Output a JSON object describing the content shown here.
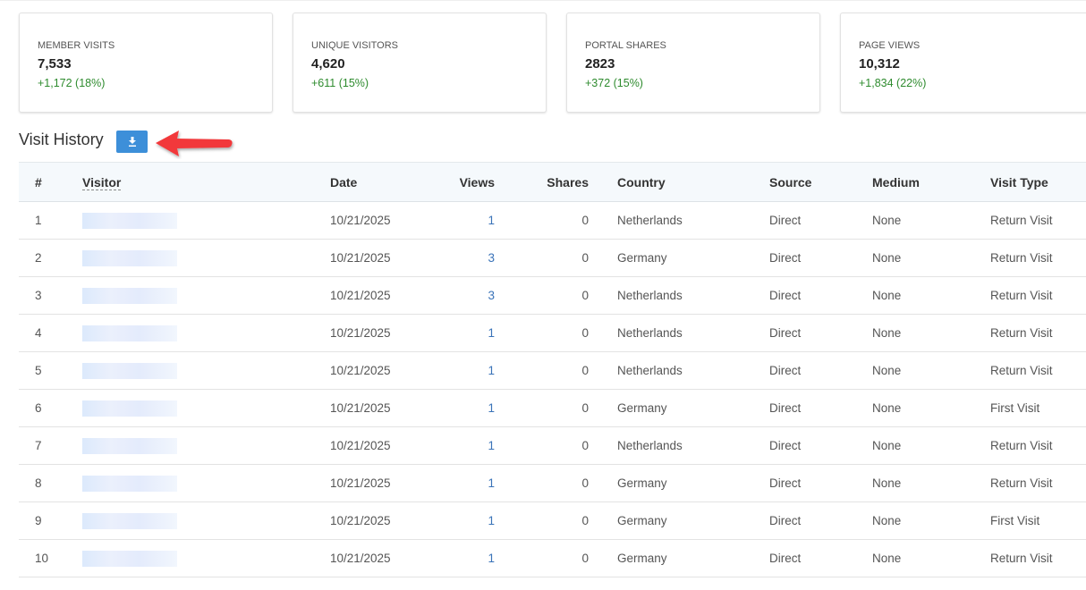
{
  "stats": [
    {
      "label": "MEMBER VISITS",
      "value": "7,533",
      "change": "+1,172 (18%)"
    },
    {
      "label": "UNIQUE VISITORS",
      "value": "4,620",
      "change": "+611 (15%)"
    },
    {
      "label": "PORTAL SHARES",
      "value": "2823",
      "change": "+372 (15%)"
    },
    {
      "label": "PAGE VIEWS",
      "value": "10,312",
      "change": "+1,834 (22%)"
    }
  ],
  "history": {
    "title": "Visit History",
    "download_icon": "download-icon",
    "columns": [
      "#",
      "Visitor",
      "Date",
      "Views",
      "Shares",
      "Country",
      "Source",
      "Medium",
      "Visit Type"
    ],
    "rows": [
      [
        "1",
        "",
        "10/21/2025",
        "1",
        "0",
        "Netherlands",
        "Direct",
        "None",
        "Return Visit"
      ],
      [
        "2",
        "",
        "10/21/2025",
        "3",
        "0",
        "Germany",
        "Direct",
        "None",
        "Return Visit"
      ],
      [
        "3",
        "",
        "10/21/2025",
        "3",
        "0",
        "Netherlands",
        "Direct",
        "None",
        "Return Visit"
      ],
      [
        "4",
        "",
        "10/21/2025",
        "1",
        "0",
        "Netherlands",
        "Direct",
        "None",
        "Return Visit"
      ],
      [
        "5",
        "",
        "10/21/2025",
        "1",
        "0",
        "Netherlands",
        "Direct",
        "None",
        "Return Visit"
      ],
      [
        "6",
        "",
        "10/21/2025",
        "1",
        "0",
        "Germany",
        "Direct",
        "None",
        "First Visit"
      ],
      [
        "7",
        "",
        "10/21/2025",
        "1",
        "0",
        "Netherlands",
        "Direct",
        "None",
        "Return Visit"
      ],
      [
        "8",
        "",
        "10/21/2025",
        "1",
        "0",
        "Germany",
        "Direct",
        "None",
        "Return Visit"
      ],
      [
        "9",
        "",
        "10/21/2025",
        "1",
        "0",
        "Germany",
        "Direct",
        "None",
        "First Visit"
      ],
      [
        "10",
        "",
        "10/21/2025",
        "1",
        "0",
        "Germany",
        "Direct",
        "None",
        "Return Visit"
      ]
    ]
  },
  "colors": {
    "accent": "#3d8fd9",
    "positive": "#2e8b2e",
    "annotation": "#e8393a"
  }
}
